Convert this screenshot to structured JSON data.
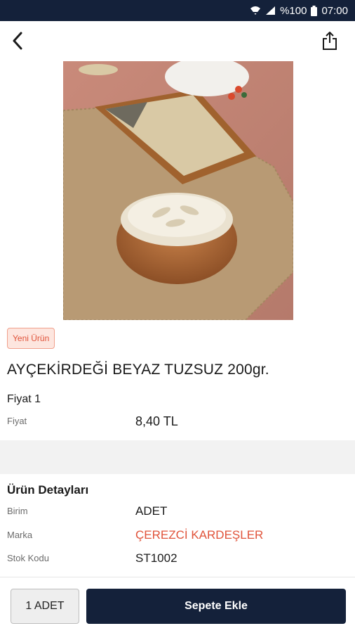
{
  "status_bar": {
    "battery_text": "%100",
    "time": "07:00",
    "icons": [
      "wifi-icon",
      "signal-icon",
      "battery-icon"
    ]
  },
  "app_bar": {
    "back_icon": "chevron-left-icon",
    "share_icon": "share-icon"
  },
  "product": {
    "badge": "Yeni Ürün",
    "title": "AYÇEKİRDEĞİ BEYAZ TUZSUZ 200gr.",
    "image_alt": "sunflower-seeds-photo"
  },
  "pricing": {
    "group_label": "Fiyat 1",
    "price_label": "Fiyat",
    "price_value": "8,40 TL"
  },
  "details": {
    "title": "Ürün Detayları",
    "rows": [
      {
        "label": "Birim",
        "value": "ADET"
      },
      {
        "label": "Marka",
        "value": "ÇEREZCİ KARDEŞLER"
      },
      {
        "label": "Stok Kodu",
        "value": "ST1002"
      }
    ]
  },
  "bottom": {
    "quantity_label": "1 ADET",
    "add_to_cart_label": "Sepete Ekle"
  },
  "colors": {
    "primary": "#14213a",
    "accent": "#e0533a",
    "badge_bg": "#fde6df"
  }
}
